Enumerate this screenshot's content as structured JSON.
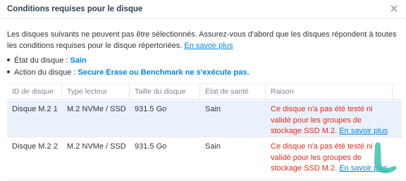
{
  "dialog": {
    "title": "Conditions requises pour le disque",
    "close_icon": "close-icon"
  },
  "intro": {
    "text": "Les disques suivants ne peuvent pas être sélectionnés. Assurez-vous d'abord que les disques répondent à toutes les conditions requises pour le disque répertoriées. ",
    "link": "En savoir plus"
  },
  "bullets": [
    {
      "label": "État du disque : ",
      "value": "Sain"
    },
    {
      "label": "Action du disque : ",
      "value": "Secure Erase ou Benchmark ne s'exécute pas."
    }
  ],
  "table": {
    "columns": [
      "ID de disque",
      "Type lecteur",
      "Taille du disque",
      "État de santé",
      "Raison"
    ],
    "rows": [
      {
        "id": "Disque M.2 1",
        "type": "M.2 NVMe / SSD",
        "size": "931.5 Go",
        "health": "Sain",
        "reason": "Ce disque n'a pas été testé ni validé pour les groupes de stockage SSD M.2. ",
        "reason_link": "En savoir plus",
        "selected": true
      },
      {
        "id": "Disque M.2 2",
        "type": "M.2 NVMe / SSD",
        "size": "931.5 Go",
        "health": "Sain",
        "reason": "Ce disque n'a pas été testé ni validé pour les groupes de stockage SSD M.2. ",
        "reason_link": "En savoir plus",
        "selected": false
      }
    ]
  },
  "colors": {
    "link": "#0086e5",
    "error": "#e6291b",
    "selected_row": "#e9f2fc",
    "brand_mark": "#3dbfae"
  }
}
